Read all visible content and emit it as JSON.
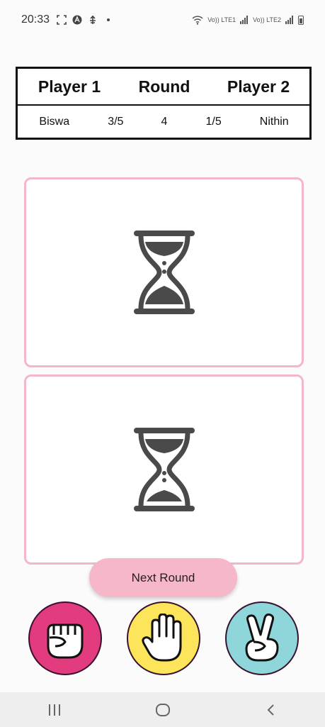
{
  "status_bar": {
    "time": "20:33",
    "signal_text_1": "Vo)) LTE1",
    "signal_text_2": "Vo)) LTE2"
  },
  "scoreboard": {
    "headers": [
      "Player 1",
      "Round",
      "Player 2"
    ],
    "player1_name": "Biswa",
    "player1_score": "3/5",
    "round": "4",
    "player2_score": "1/5",
    "player2_name": "Nithin"
  },
  "cards": [
    {
      "icon": "hourglass-icon"
    },
    {
      "icon": "hourglass-icon"
    }
  ],
  "next_round_label": "Next Round",
  "hands": [
    {
      "name": "rock",
      "icon": "fist-icon",
      "color": "#e23b7e"
    },
    {
      "name": "paper",
      "icon": "open-hand-icon",
      "color": "#fce55a"
    },
    {
      "name": "scissors",
      "icon": "victory-hand-icon",
      "color": "#8ed6d9"
    }
  ],
  "nav_bar": {
    "recent_icon": "recent-apps-icon",
    "home_icon": "home-icon",
    "back_icon": "back-icon"
  },
  "colors": {
    "card_border": "#f2b8c8",
    "next_round_bg": "#f6b7c8",
    "hourglass": "#4a4a4a"
  }
}
